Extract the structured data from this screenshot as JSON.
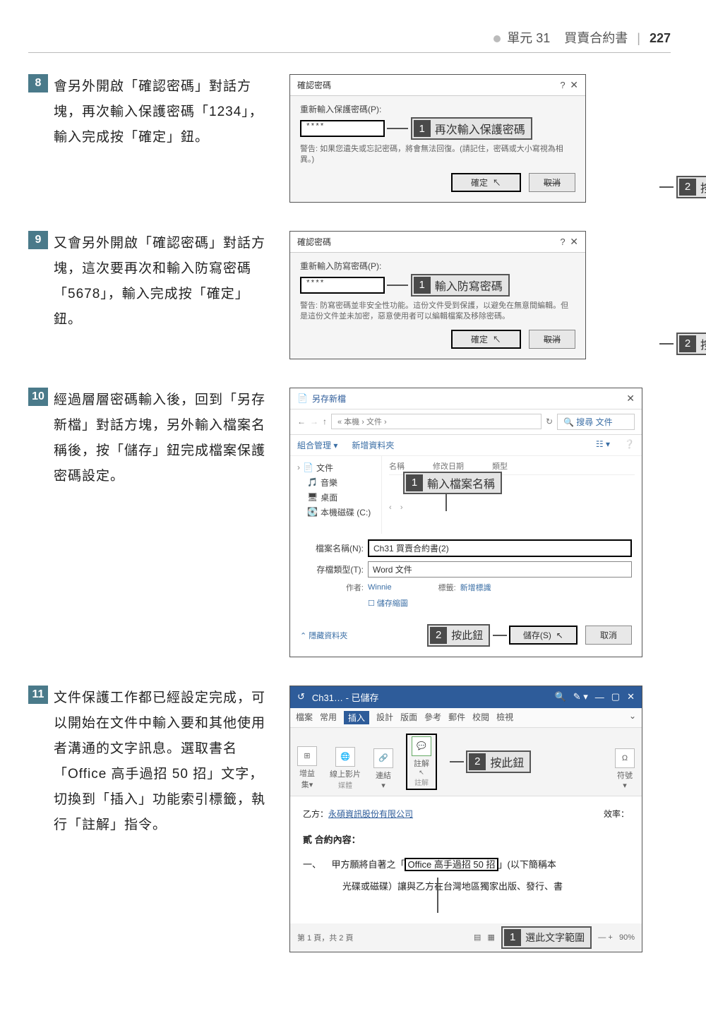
{
  "header": {
    "unit": "單元 31",
    "title": "買賣合約書",
    "page": "227"
  },
  "steps": {
    "s8": {
      "num": "8",
      "desc": "會另外開啟「確認密碼」對話方塊，再次輸入保護密碼「1234」，輸入完成按「確定」鈕。",
      "dlg_title": "確認密碼",
      "label": "重新輸入保護密碼(P):",
      "pwd": "****",
      "warn": "警告: 如果您遺失或忘記密碼，將會無法回復。(請記住，密碼或大小寫視為相異。)",
      "ok": "確定",
      "cancel": "取消",
      "co1": "再次輸入保護密碼",
      "co2": "按此鈕"
    },
    "s9": {
      "num": "9",
      "desc": "又會另外開啟「確認密碼」對話方塊，這次要再次和輸入防寫密碼「5678」，輸入完成按「確定」鈕。",
      "dlg_title": "確認密碼",
      "label": "重新輸入防寫密碼(P):",
      "pwd": "****",
      "warn": "警告: 防寫密碼並非安全性功能。這份文件受到保護，以避免在無意間編輯。但是這份文件並未加密，惡意使用者可以編輯檔案及移除密碼。",
      "ok": "確定",
      "cancel": "取消",
      "co1": "輸入防寫密碼",
      "co2": "按此鈕"
    },
    "s10": {
      "num": "10",
      "desc": "經過層層密碼輸入後，回到「另存新檔」對話方塊，另外輸入檔案名稱後，按「儲存」鈕完成檔案保護密碼設定。",
      "title": "另存新檔",
      "crumb": "« 本機 › 文件 ›",
      "search_ph": "搜尋 文件",
      "org": "組合管理 ▾",
      "newf": "新增資料夾",
      "col_name": "名稱",
      "col_date": "修改日期",
      "col_type": "類型",
      "tree": {
        "docs": "文件",
        "music": "音樂",
        "desktop": "桌面",
        "cdrive": "本機磁碟 (C:)"
      },
      "fn_label": "檔案名稱(N):",
      "fn": "Ch31 買賣合約書(2)",
      "ft_label": "存檔類型(T):",
      "ft": "Word 文件",
      "author_l": "作者:",
      "author": "Winnie",
      "tag_l": "標籤:",
      "tag": "新增標識",
      "thumb": "儲存縮圖",
      "hide": "隱藏資料夾",
      "save": "儲存(S)",
      "cancel": "取消",
      "co1": "輸入檔案名稱",
      "co2": "按此鈕"
    },
    "s11": {
      "num": "11",
      "desc": "文件保護工作都已經設定完成，可以開始在文件中輸入要和其他使用者溝通的文字訊息。選取書名「Office 高手過招 50 招」文字，切換到「插入」功能索引標籤，執行「註解」指令。",
      "wt": "Ch31… - 已儲存",
      "tabs": {
        "file": "檔案",
        "home": "常用",
        "insert": "插入",
        "design": "設計",
        "layout": "版面",
        "ref": "參考",
        "mail": "郵件",
        "review": "校閱",
        "view": "檢視"
      },
      "rb": {
        "video": "線上影片",
        "link": "連結",
        "comment": "註解",
        "sym": "符號",
        "g_media": "媒體",
        "g_comment": "註解"
      },
      "doc_p1a": "乙方：",
      "doc_p1b": "永碩資訊股份有限公司",
      "doc_p1c": "效率：",
      "doc_h": "貳 合約內容：",
      "doc_p2a": "一、",
      "doc_p2b": "甲方願將自著之「",
      "doc_p2c": "Office 高手過招 50 招",
      "doc_p2d": "」(以下簡稱本",
      "doc_p3": "光碟或磁碟）讓與乙方在台灣地區獨家出版、發行、書",
      "status_l": "第 1 頁，共 2 頁",
      "status_r": "90%",
      "co1": "選此文字範圍",
      "co2": "按此鈕"
    }
  }
}
